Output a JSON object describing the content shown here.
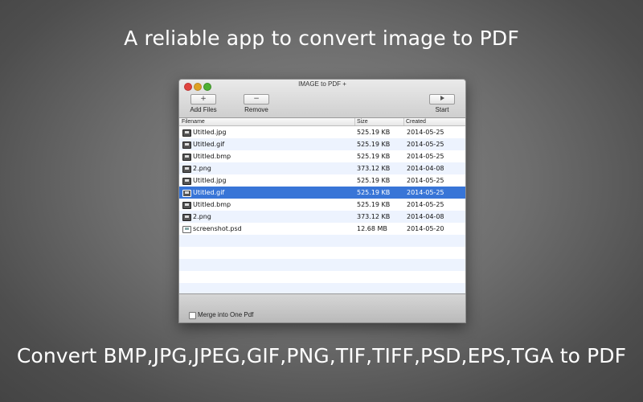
{
  "headline_top": "A reliable app to convert image to PDF",
  "headline_bottom": "Convert BMP,JPG,JPEG,GIF,PNG,TIF,TIFF,PSD,EPS,TGA to PDF",
  "window": {
    "title": "IMAGE to PDF +",
    "toolbar": {
      "add_symbol": "+",
      "add_label": "Add Files",
      "remove_symbol": "−",
      "remove_label": "Remove",
      "start_label": "Start"
    },
    "columns": {
      "filename": "Filename",
      "size": "Size",
      "created": "Created"
    },
    "files": [
      {
        "name": "Utitled.jpg",
        "size": "525.19 KB",
        "created": "2014-05-25",
        "icon": "image-file-icon"
      },
      {
        "name": "Utitled.gif",
        "size": "525.19 KB",
        "created": "2014-05-25",
        "icon": "image-file-icon"
      },
      {
        "name": "Utitled.bmp",
        "size": "525.19 KB",
        "created": "2014-05-25",
        "icon": "image-file-icon"
      },
      {
        "name": "2.png",
        "size": "373.12 KB",
        "created": "2014-04-08",
        "icon": "image-file-icon"
      },
      {
        "name": "Utitled.jpg",
        "size": "525.19 KB",
        "created": "2014-05-25",
        "icon": "image-file-icon"
      },
      {
        "name": "Utitled.gif",
        "size": "525.19 KB",
        "created": "2014-05-25",
        "icon": "image-file-icon",
        "selected": true
      },
      {
        "name": "Utitled.bmp",
        "size": "525.19 KB",
        "created": "2014-05-25",
        "icon": "image-file-icon"
      },
      {
        "name": "2.png",
        "size": "373.12 KB",
        "created": "2014-04-08",
        "icon": "image-file-icon"
      },
      {
        "name": "screenshot.psd",
        "size": "12.68 MB",
        "created": "2014-05-20",
        "icon": "psd-file-icon"
      }
    ],
    "empty_rows": 6,
    "merge_label": "Merge into One Pdf",
    "merge_checked": false,
    "selection_color": "#3875d7"
  }
}
